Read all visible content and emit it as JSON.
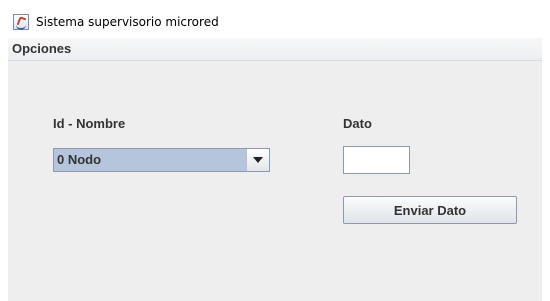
{
  "window": {
    "title": "Sistema supervisorio microred",
    "icon": "java-cup-icon"
  },
  "menubar": {
    "items": [
      {
        "label": "Opciones"
      }
    ]
  },
  "form": {
    "id_nombre_label": "Id - Nombre",
    "dato_label": "Dato",
    "node_select": {
      "selected": "0 Nodo"
    },
    "dato_input": {
      "value": "",
      "placeholder": ""
    },
    "send_button_label": "Enviar Dato"
  },
  "colors": {
    "content_bg": "#eeeeee",
    "combo_selected_bg": "#b5c5dc",
    "control_border": "#8a9ab3",
    "text": "#333333"
  }
}
